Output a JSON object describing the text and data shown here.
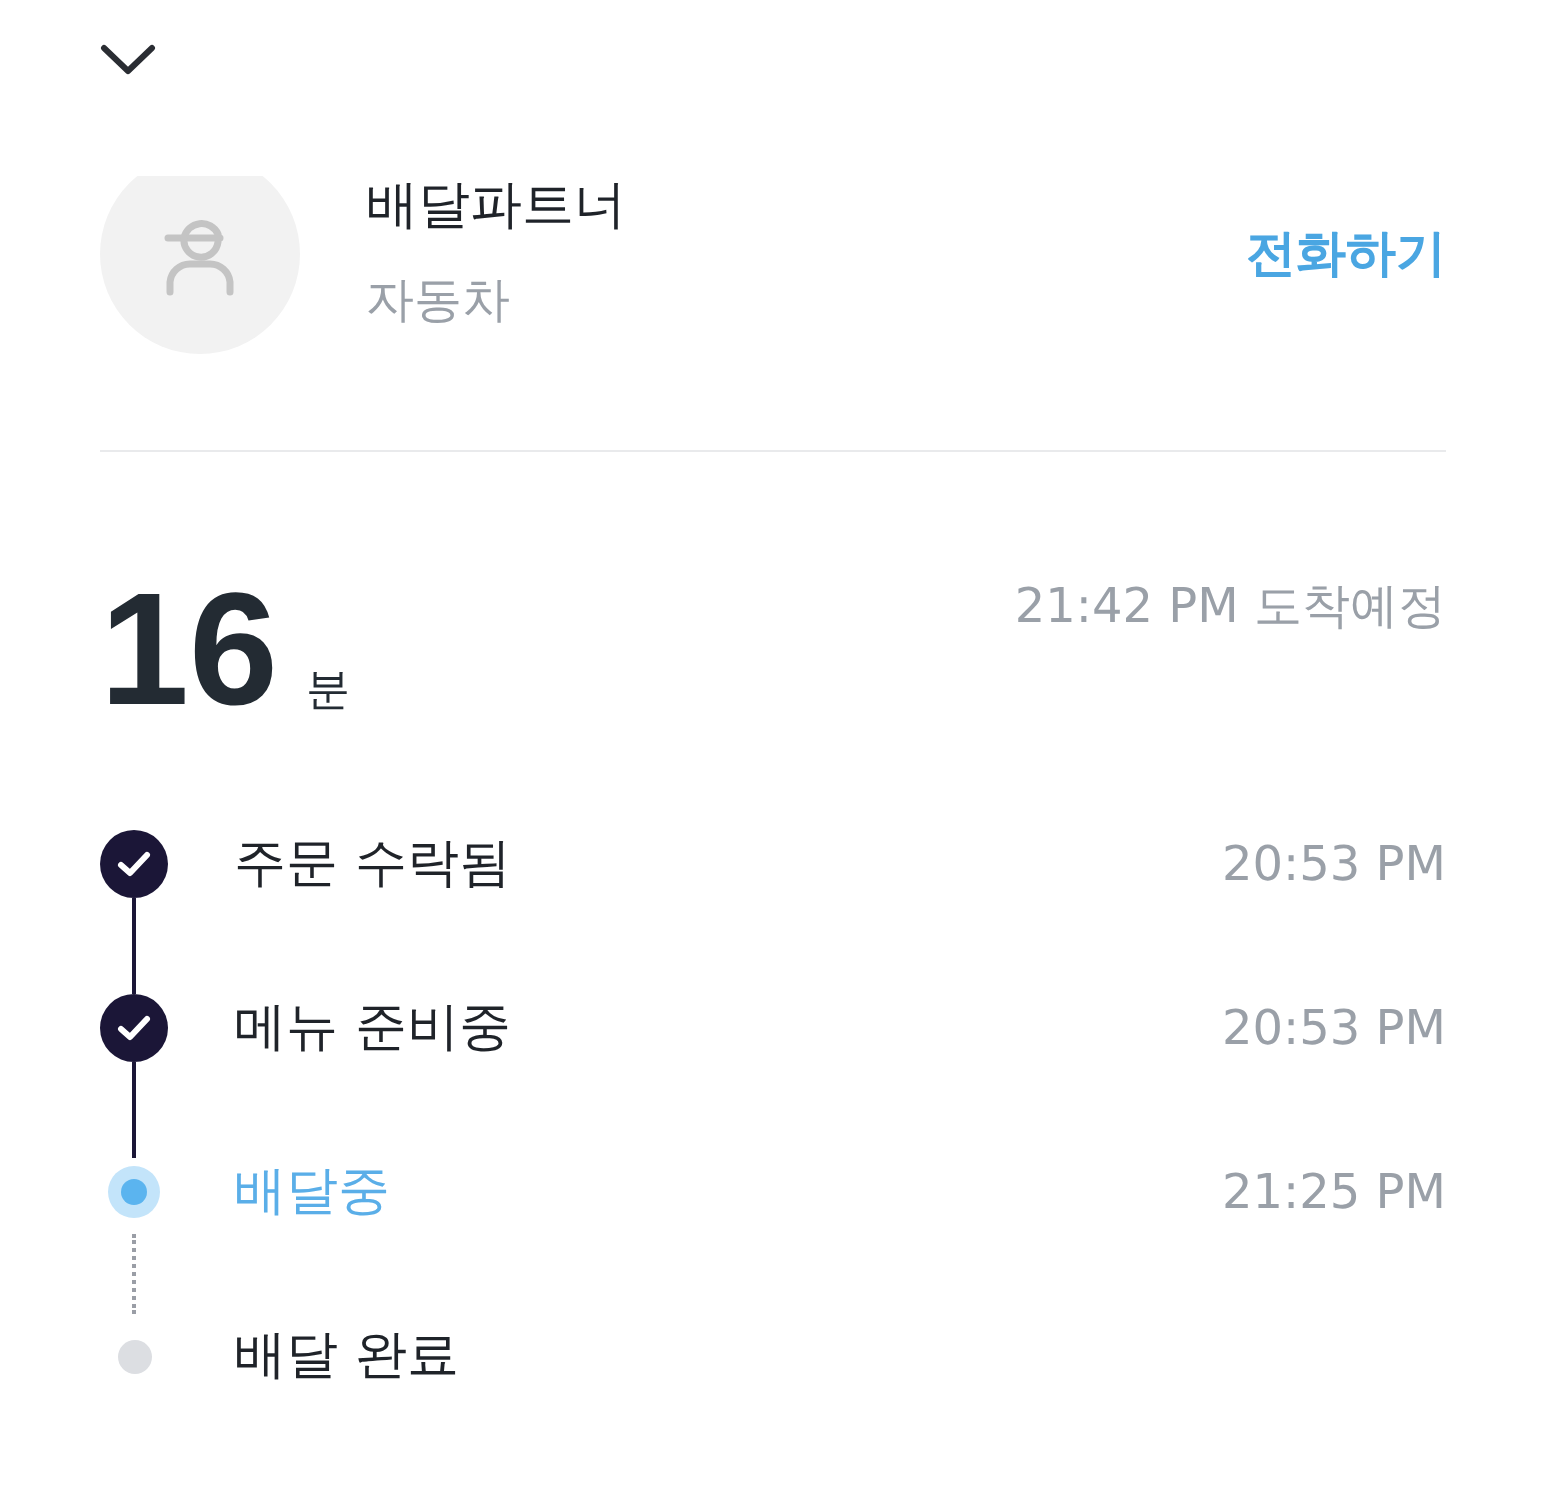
{
  "partner": {
    "name": "배달파트너",
    "vehicle": "자동차",
    "call_label": "전화하기"
  },
  "eta": {
    "minutes": "16",
    "unit": "분",
    "arrival": "21:42 PM 도착예정"
  },
  "steps": [
    {
      "label": "주문 수락됨",
      "time": "20:53 PM",
      "kind": "done"
    },
    {
      "label": "메뉴 준비중",
      "time": "20:53 PM",
      "kind": "done"
    },
    {
      "label": "배달중",
      "time": "21:25 PM",
      "kind": "current"
    },
    {
      "label": "배달 완료",
      "kind": "pending"
    }
  ]
}
